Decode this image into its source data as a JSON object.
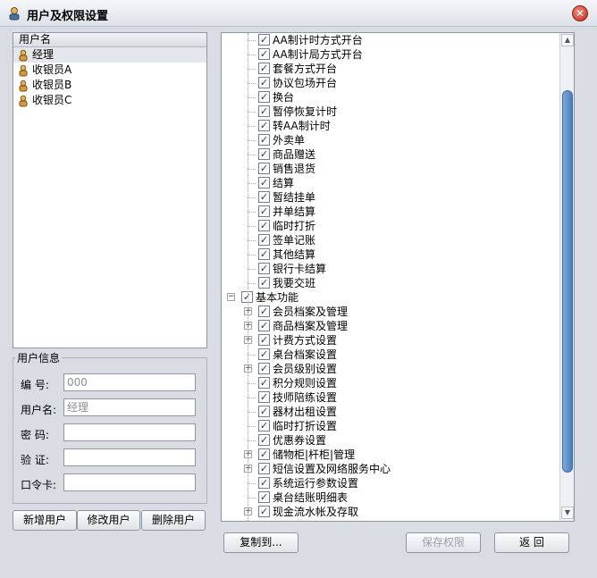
{
  "window": {
    "title": "用户及权限设置",
    "close_label": "✕"
  },
  "user_list": {
    "header": "用户名",
    "items": [
      {
        "label": "经理",
        "selected": true
      },
      {
        "label": "收银员A",
        "selected": false
      },
      {
        "label": "收银员B",
        "selected": false
      },
      {
        "label": "收银员C",
        "selected": false
      }
    ]
  },
  "user_info": {
    "legend": "用户信息",
    "number_label": "编  号:",
    "number_value": "000",
    "username_label": "用户名:",
    "username_value": "经理",
    "password_label": "密  码:",
    "password_value": "",
    "confirm_label": "验  证:",
    "confirm_value": "",
    "token_label": "口令卡:",
    "token_value": ""
  },
  "user_buttons": {
    "add": "新增用户",
    "edit": "修改用户",
    "delete": "删除用户"
  },
  "permission_tree": {
    "rows": [
      {
        "label": "AA制计时方式开台",
        "level": 2,
        "checked": true,
        "expander": false
      },
      {
        "label": "AA制计局方式开台",
        "level": 2,
        "checked": true,
        "expander": false
      },
      {
        "label": "套餐方式开台",
        "level": 2,
        "checked": true,
        "expander": false
      },
      {
        "label": "协议包场开台",
        "level": 2,
        "checked": true,
        "expander": false
      },
      {
        "label": "换台",
        "level": 2,
        "checked": true,
        "expander": false
      },
      {
        "label": "暂停恢复计时",
        "level": 2,
        "checked": true,
        "expander": false
      },
      {
        "label": "转AA制计时",
        "level": 2,
        "checked": true,
        "expander": false
      },
      {
        "label": "外卖单",
        "level": 2,
        "checked": true,
        "expander": false
      },
      {
        "label": "商品赠送",
        "level": 2,
        "checked": true,
        "expander": false
      },
      {
        "label": "销售退货",
        "level": 2,
        "checked": true,
        "expander": false
      },
      {
        "label": "结算",
        "level": 2,
        "checked": true,
        "expander": false
      },
      {
        "label": "暂结挂单",
        "level": 2,
        "checked": true,
        "expander": false
      },
      {
        "label": "并单结算",
        "level": 2,
        "checked": true,
        "expander": false
      },
      {
        "label": "临时打折",
        "level": 2,
        "checked": true,
        "expander": false
      },
      {
        "label": "签单记账",
        "level": 2,
        "checked": true,
        "expander": false
      },
      {
        "label": "其他结算",
        "level": 2,
        "checked": true,
        "expander": false
      },
      {
        "label": "银行卡结算",
        "level": 2,
        "checked": true,
        "expander": false
      },
      {
        "label": "我要交班",
        "level": 2,
        "checked": true,
        "expander": false
      },
      {
        "label": "基本功能",
        "level": 1,
        "checked": true,
        "expander": "−"
      },
      {
        "label": "会员档案及管理",
        "level": 2,
        "checked": true,
        "expander": "+"
      },
      {
        "label": "商品档案及管理",
        "level": 2,
        "checked": true,
        "expander": "+"
      },
      {
        "label": "计费方式设置",
        "level": 2,
        "checked": true,
        "expander": "+"
      },
      {
        "label": "桌台档案设置",
        "level": 2,
        "checked": true,
        "expander": false
      },
      {
        "label": "会员级别设置",
        "level": 2,
        "checked": true,
        "expander": "+"
      },
      {
        "label": "积分规则设置",
        "level": 2,
        "checked": true,
        "expander": false
      },
      {
        "label": "技师陪练设置",
        "level": 2,
        "checked": true,
        "expander": false
      },
      {
        "label": "器材出租设置",
        "level": 2,
        "checked": true,
        "expander": false
      },
      {
        "label": "临时打折设置",
        "level": 2,
        "checked": true,
        "expander": false
      },
      {
        "label": "优惠券设置",
        "level": 2,
        "checked": true,
        "expander": false
      },
      {
        "label": "储物柜|杆柜|管理",
        "level": 2,
        "checked": true,
        "expander": "+"
      },
      {
        "label": "短信设置及网络服务中心",
        "level": 2,
        "checked": true,
        "expander": "+"
      },
      {
        "label": "系统运行参数设置",
        "level": 2,
        "checked": true,
        "expander": false
      },
      {
        "label": "桌台结账明细表",
        "level": 2,
        "checked": true,
        "expander": false
      },
      {
        "label": "现金流水帐及存取",
        "level": 2,
        "checked": true,
        "expander": "+"
      }
    ]
  },
  "bottom_buttons": {
    "copy_to": "复制到...",
    "save": "保存权限",
    "back": "返  回"
  },
  "icons": {
    "window_icon": "user-permission-icon",
    "user_icon": "user-key-icon",
    "check_icon": "checkmark-icon"
  }
}
